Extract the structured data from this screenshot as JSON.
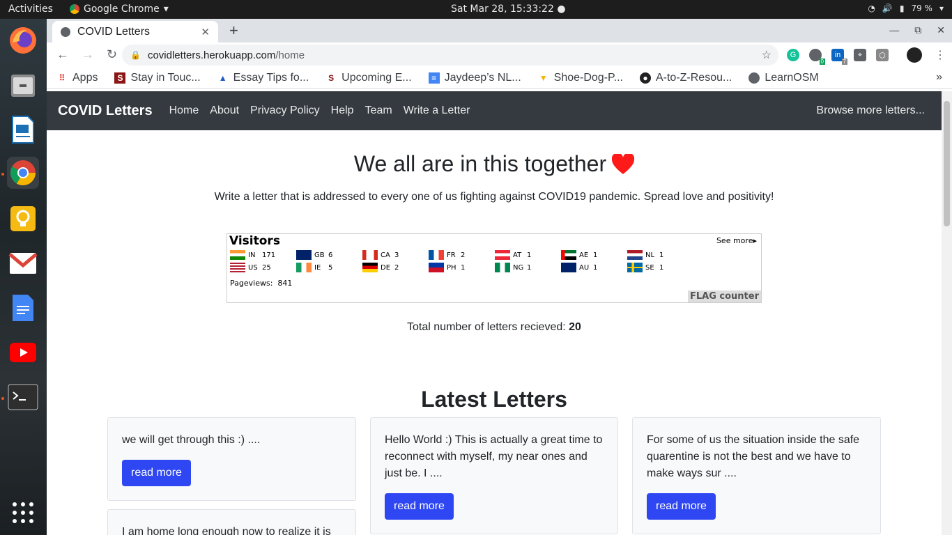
{
  "system": {
    "activities": "Activities",
    "app_name": "Google Chrome",
    "clock": "Sat Mar 28, 15:33:22",
    "battery": "79 %"
  },
  "dock": [
    "firefox-icon",
    "files-icon",
    "writer-icon",
    "chrome-icon",
    "idea-icon",
    "gmail-icon",
    "docs-icon",
    "youtube-icon",
    "terminal-icon",
    "apps-grid-icon"
  ],
  "browser": {
    "tab_title": "COVID Letters",
    "url_host": "covidletters.herokuapp.com",
    "url_path": "/home",
    "ext_badges": [
      "0",
      "7"
    ],
    "bookmarks": [
      "Apps",
      "Stay in Touc...",
      "Essay Tips fo...",
      "Upcoming E...",
      "Jaydeep’s NL...",
      "Shoe-Dog-P...",
      "A-to-Z-Resou...",
      "LearnOSM"
    ]
  },
  "site": {
    "brand": "COVID Letters",
    "nav": [
      "Home",
      "About",
      "Privacy Policy",
      "Help",
      "Team",
      "Write a Letter"
    ],
    "browse": "Browse more letters...",
    "headline": "We all are in this together",
    "subhead": "Write a letter that is addressed to every one of us fighting against COVID19 pandemic. Spread love and positivity!",
    "visitors_title": "Visitors",
    "see_more": "See more",
    "flags": [
      {
        "code": "IN",
        "count": "171"
      },
      {
        "code": "GB",
        "count": "6"
      },
      {
        "code": "CA",
        "count": "3"
      },
      {
        "code": "FR",
        "count": "2"
      },
      {
        "code": "AT",
        "count": "1"
      },
      {
        "code": "AE",
        "count": "1"
      },
      {
        "code": "NL",
        "count": "1"
      },
      {
        "code": "US",
        "count": "25"
      },
      {
        "code": "IE",
        "count": "5"
      },
      {
        "code": "DE",
        "count": "2"
      },
      {
        "code": "PH",
        "count": "1"
      },
      {
        "code": "NG",
        "count": "1"
      },
      {
        "code": "AU",
        "count": "1"
      },
      {
        "code": "SE",
        "count": "1"
      }
    ],
    "pageviews_label": "Pageviews:",
    "pageviews": "841",
    "flag_counter": "FLAG counter",
    "total_label": "Total number of letters recieved:",
    "total_value": "20",
    "latest_title": "Latest Letters",
    "read_more": "read more",
    "letters": [
      "we will get through this :) ....",
      "Hello World :) This is actually a great time to reconnect with myself, my near ones and just be. I ....",
      "For some of us the situation inside the safe quarentine is not the best and we have to make ways sur ....",
      "I am home long enough now to realize it is"
    ]
  }
}
